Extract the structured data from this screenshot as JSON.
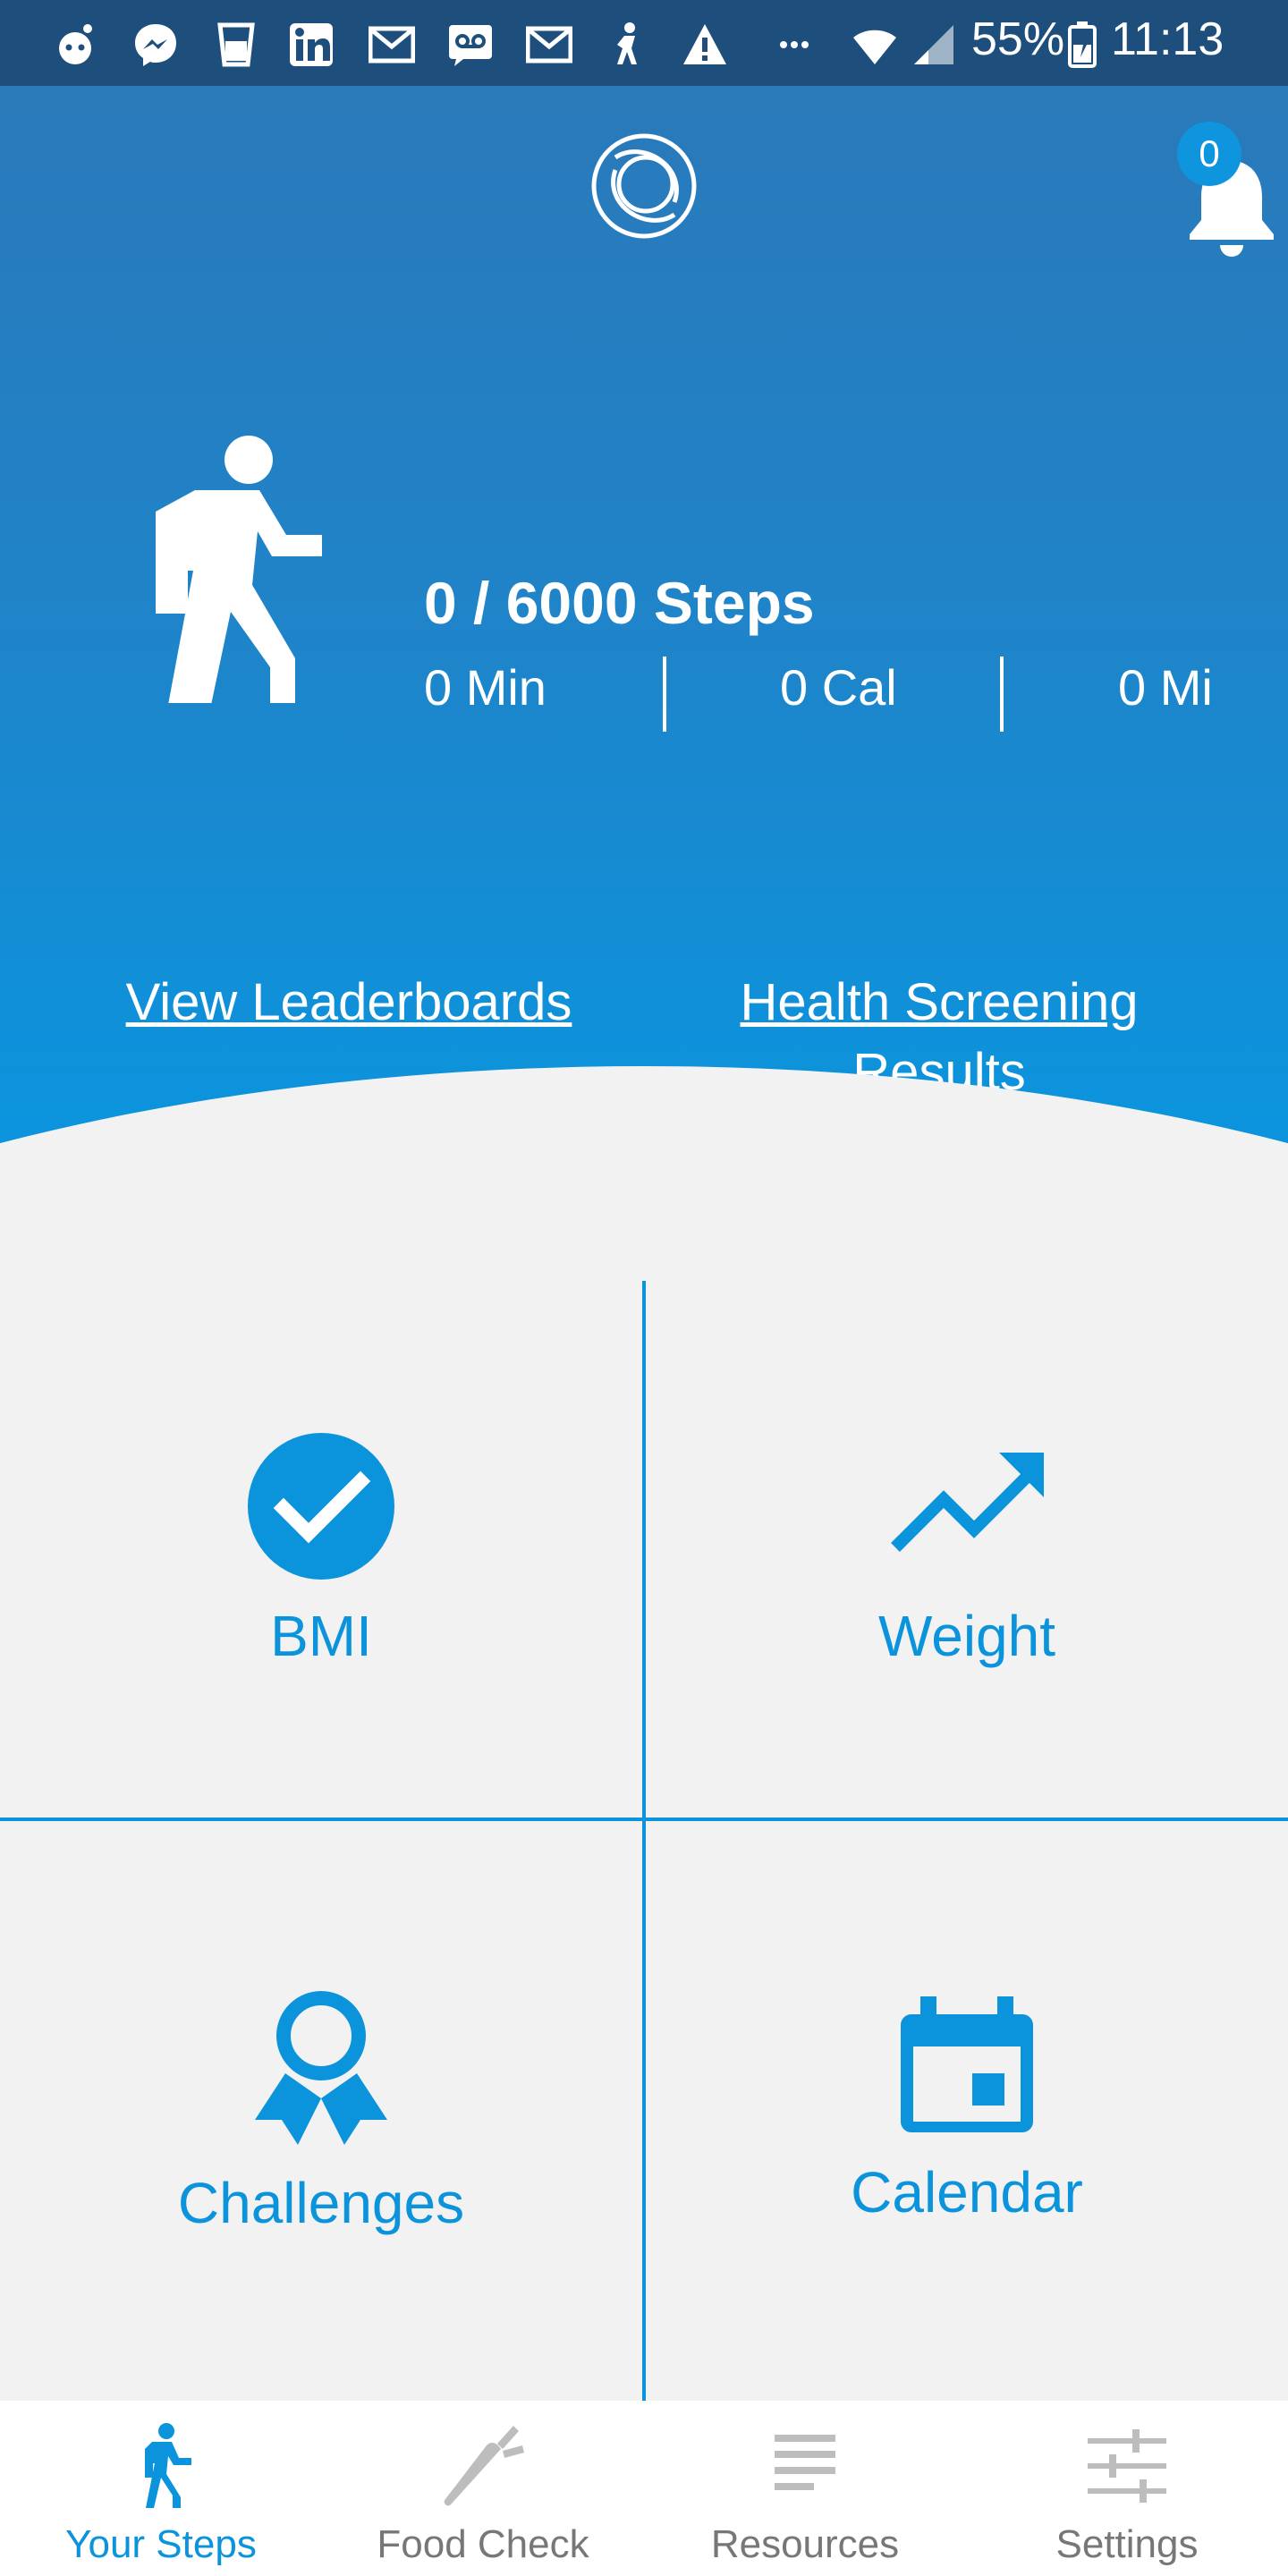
{
  "status_bar": {
    "battery": "55%",
    "time": "11:13",
    "icons": [
      "reddit-icon",
      "messenger-icon",
      "cup-icon",
      "linkedin-icon",
      "gmail-icon",
      "voicemail-icon",
      "gmail-icon",
      "figure-icon",
      "warning-icon",
      "more-icon",
      "wifi-icon",
      "signal-icon",
      "battery-icon"
    ]
  },
  "header": {
    "notification_count": "0"
  },
  "steps": {
    "title": "0 / 6000 Steps",
    "minutes": "0 Min",
    "calories": "0 Cal",
    "miles": "0 Mi"
  },
  "links": {
    "leaderboards": "View Leaderboards",
    "health_screening_line1": "Health Screening",
    "health_screening_line2": "Results"
  },
  "tiles": [
    {
      "label": "BMI",
      "icon": "check-circle-icon"
    },
    {
      "label": "Weight",
      "icon": "trend-up-icon"
    },
    {
      "label": "Challenges",
      "icon": "ribbon-icon"
    },
    {
      "label": "Calendar",
      "icon": "calendar-icon"
    }
  ],
  "nav": [
    {
      "label": "Your Steps",
      "icon": "walker-icon",
      "active": true
    },
    {
      "label": "Food Check",
      "icon": "carrot-icon"
    },
    {
      "label": "Resources",
      "icon": "list-icon"
    },
    {
      "label": "Settings",
      "icon": "sliders-icon"
    }
  ],
  "colors": {
    "accent": "#0b93dc",
    "status_bar": "#1e4f7c"
  }
}
